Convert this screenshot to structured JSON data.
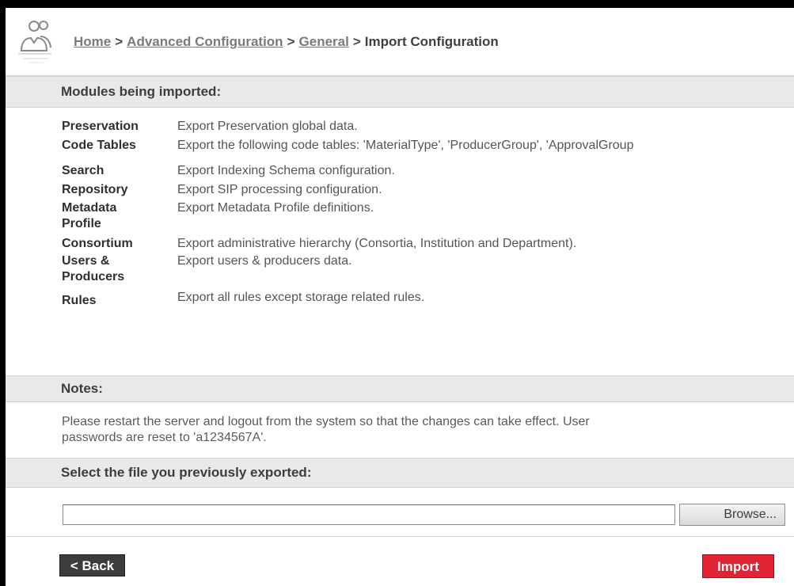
{
  "breadcrumb": {
    "home": "Home",
    "advanced": "Advanced Configuration",
    "general": "General",
    "current": "Import Configuration",
    "separator": ">"
  },
  "sections": {
    "modules_header": "Modules being imported:",
    "notes_header": "Notes:",
    "select_header": "Select the file you previously exported:"
  },
  "modules": [
    {
      "name": "Preservation",
      "description": "Export Preservation global data."
    },
    {
      "name": "Code Tables",
      "description": "Export the following code tables: 'MaterialType', 'ProducerGroup', 'ApprovalGroup"
    },
    {
      "name": "Search",
      "description": "Export Indexing Schema configuration."
    },
    {
      "name": "Repository",
      "description": "Export SIP processing configuration."
    },
    {
      "name": "Metadata Profile",
      "description": "Export Metadata Profile definitions."
    },
    {
      "name": "Consortium",
      "description": "Export administrative hierarchy (Consortia, Institution and Department)."
    },
    {
      "name": "Users & Producers",
      "description": "Export users & producers data."
    },
    {
      "name": "Rules",
      "description": "Export all rules except storage related rules."
    }
  ],
  "notes": {
    "line1": "Please restart the server and logout from the system so that the changes can take effect. User",
    "line2": "passwords are reset to 'a1234567A'."
  },
  "file": {
    "value": "",
    "browse_label": "Browse..."
  },
  "buttons": {
    "back": "< Back",
    "import": "Import"
  },
  "colors": {
    "import_button": "#e02433",
    "back_button": "#3c3c3c",
    "section_bar": "#e9e9e9"
  },
  "icons": {
    "header": "users-icon"
  }
}
